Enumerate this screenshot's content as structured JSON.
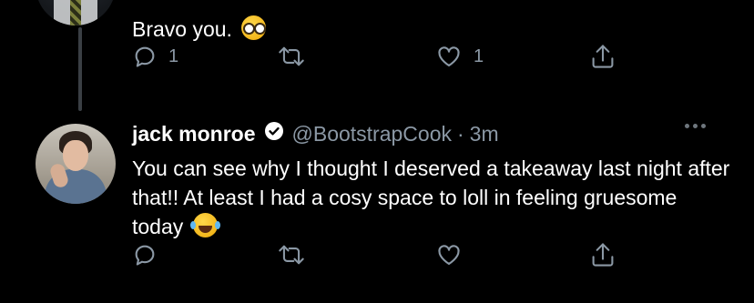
{
  "reply_tweet": {
    "text": "Bravo you.",
    "emoji": "nerd-face",
    "reply_count": "1",
    "retweet_count": "",
    "like_count": "1"
  },
  "main_tweet": {
    "display_name": "jack monroe",
    "handle": "@BootstrapCook",
    "separator": "·",
    "time": "3m",
    "text": "You can see why I thought I deserved a takeaway last night after that!! At least I had a cosy space to loll in feeling gruesome today",
    "emoji": "face-with-tears-of-joy",
    "reply_count": "",
    "retweet_count": "",
    "like_count": ""
  },
  "icons": {
    "reply": "reply-icon",
    "retweet": "retweet-icon",
    "like": "heart-icon",
    "share": "share-icon",
    "verified": "verified-badge-icon",
    "more": "more-icon"
  },
  "colors": {
    "background": "#000000",
    "text": "#ffffff",
    "secondary": "#8b98a5",
    "thread_line": "#3a3f44"
  }
}
